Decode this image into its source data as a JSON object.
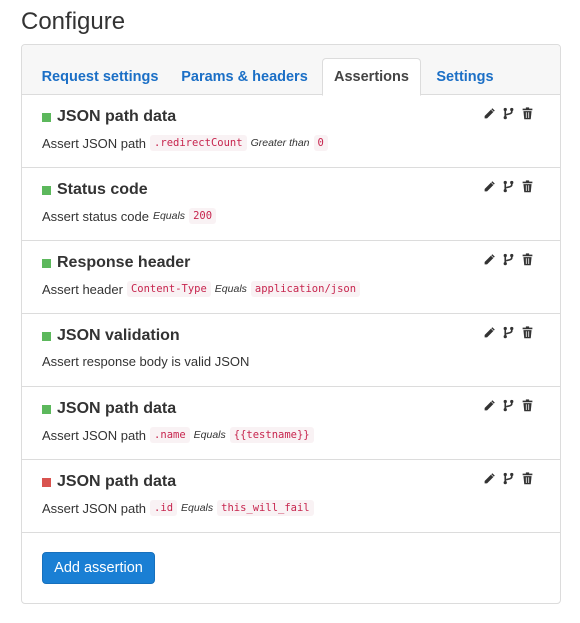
{
  "page": {
    "title": "Configure"
  },
  "tabs": [
    {
      "label": "Request settings",
      "active": false
    },
    {
      "label": "Params & headers",
      "active": false
    },
    {
      "label": "Assertions",
      "active": true
    },
    {
      "label": "Settings",
      "active": false
    }
  ],
  "status_colors": {
    "pass": "#5cb85c",
    "fail": "#d9534f"
  },
  "icons": [
    "pencil-icon",
    "fork-icon",
    "trash-icon"
  ],
  "assertions": [
    {
      "title": "JSON path data",
      "status": "pass",
      "desc_prefix": "Assert JSON path",
      "target": ".redirectCount",
      "operator": "Greater than",
      "value": "0"
    },
    {
      "title": "Status code",
      "status": "pass",
      "desc_prefix": "Assert status code",
      "target": "",
      "operator": "Equals",
      "value": "200"
    },
    {
      "title": "Response header",
      "status": "pass",
      "desc_prefix": "Assert header",
      "target": "Content-Type",
      "operator": "Equals",
      "value": "application/json"
    },
    {
      "title": "JSON validation",
      "status": "pass",
      "desc_prefix": "Assert response body is valid JSON",
      "target": "",
      "operator": "",
      "value": ""
    },
    {
      "title": "JSON path data",
      "status": "pass",
      "desc_prefix": "Assert JSON path",
      "target": ".name",
      "operator": "Equals",
      "value": "{{testname}}"
    },
    {
      "title": "JSON path data",
      "status": "fail",
      "desc_prefix": "Assert JSON path",
      "target": ".id",
      "operator": "Equals",
      "value": "this_will_fail"
    }
  ],
  "add_button": {
    "label": "Add assertion"
  }
}
